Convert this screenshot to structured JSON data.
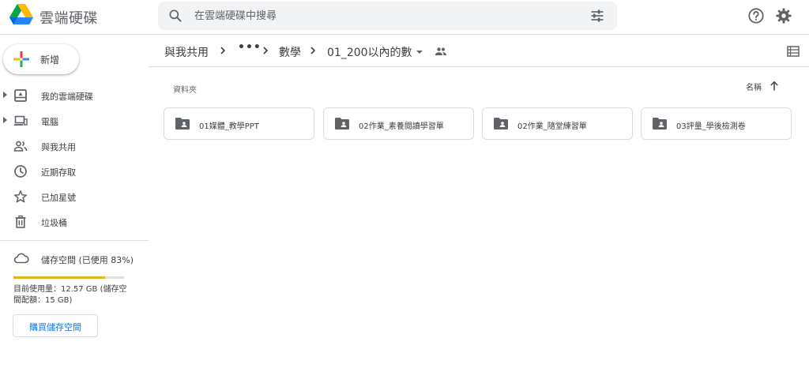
{
  "app": {
    "title": "雲端硬碟"
  },
  "search": {
    "placeholder": "在雲端硬碟中搜尋",
    "value": ""
  },
  "sidebar": {
    "new_label": "新增",
    "items": [
      {
        "label": "我的雲端硬碟",
        "icon": "my-drive-icon",
        "expandable": true
      },
      {
        "label": "電腦",
        "icon": "computers-icon",
        "expandable": true
      },
      {
        "label": "與我共用",
        "icon": "shared-with-me-icon",
        "expandable": false
      },
      {
        "label": "近期存取",
        "icon": "recent-clock-icon",
        "expandable": false
      },
      {
        "label": "已加星號",
        "icon": "star-icon",
        "expandable": false
      },
      {
        "label": "垃圾桶",
        "icon": "trash-icon",
        "expandable": false
      }
    ],
    "storage": {
      "label": "儲存空間 (已使用 83%)",
      "used_fraction": 0.83,
      "detail": "目前使用量：12.57 GB (儲存空間配額：15 GB)",
      "buy_label": "購買儲存空間",
      "bar_color": "#e9b31b"
    }
  },
  "breadcrumb": {
    "root": "與我共用",
    "more": "•••",
    "parent": "數學",
    "current": "01_200以內的數"
  },
  "content": {
    "section_label": "資料夾",
    "sort_label": "名稱",
    "folders": [
      {
        "name": "01媒體_教學PPT"
      },
      {
        "name": "02作業_素養閱讀學習單"
      },
      {
        "name": "02作業_隨堂練習單"
      },
      {
        "name": "03評量_學後檢測卷"
      }
    ]
  },
  "colors": {
    "accent": "#1a73e8",
    "icon": "#5f6368",
    "text": "#3c4043",
    "border": "#dadce0"
  }
}
